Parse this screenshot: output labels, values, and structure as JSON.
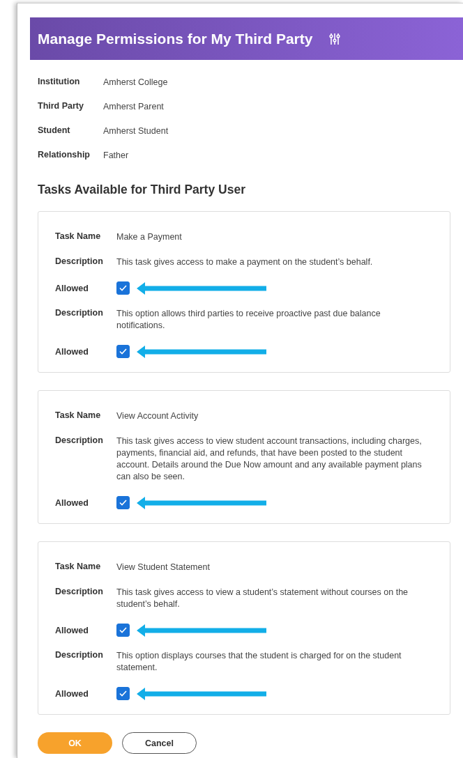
{
  "header": {
    "title": "Manage Permissions for My Third Party"
  },
  "info": [
    {
      "label": "Institution",
      "value": "Amherst College"
    },
    {
      "label": "Third Party",
      "value": "Amherst Parent"
    },
    {
      "label": "Student",
      "value": "Amherst Student"
    },
    {
      "label": "Relationship",
      "value": "Father"
    }
  ],
  "section_title": "Tasks Available for Third Party User",
  "tasks": [
    {
      "rows": [
        {
          "kind": "field",
          "label": "Task Name",
          "value": "Make a Payment"
        },
        {
          "kind": "field",
          "label": "Description",
          "value": "This task gives access to make a payment on the student’s behalf."
        },
        {
          "kind": "checkbox",
          "label": "Allowed",
          "checked": true
        },
        {
          "kind": "field",
          "label": "Description",
          "value": "This option allows third parties to receive proactive past due balance notifications."
        },
        {
          "kind": "checkbox",
          "label": "Allowed",
          "checked": true
        }
      ]
    },
    {
      "rows": [
        {
          "kind": "field",
          "label": "Task Name",
          "value": "View Account Activity"
        },
        {
          "kind": "field",
          "label": "Description",
          "value": "This task gives access to view student account transactions, including charges, payments, financial aid, and refunds, that have been posted to the student account. Details around the Due Now amount and any available payment plans can also be seen."
        },
        {
          "kind": "checkbox",
          "label": "Allowed",
          "checked": true
        }
      ]
    },
    {
      "rows": [
        {
          "kind": "field",
          "label": "Task Name",
          "value": "View Student Statement"
        },
        {
          "kind": "field",
          "label": "Description",
          "value": "This task gives access to view a student’s statement without courses on the student’s behalf."
        },
        {
          "kind": "checkbox",
          "label": "Allowed",
          "checked": true
        },
        {
          "kind": "field",
          "label": "Description",
          "value": "This option displays courses that the student is charged for on the student statement."
        },
        {
          "kind": "checkbox",
          "label": "Allowed",
          "checked": true
        }
      ]
    }
  ],
  "buttons": [
    {
      "kind": "primary",
      "label": "OK"
    },
    {
      "kind": "secondary",
      "label": "Cancel"
    }
  ]
}
